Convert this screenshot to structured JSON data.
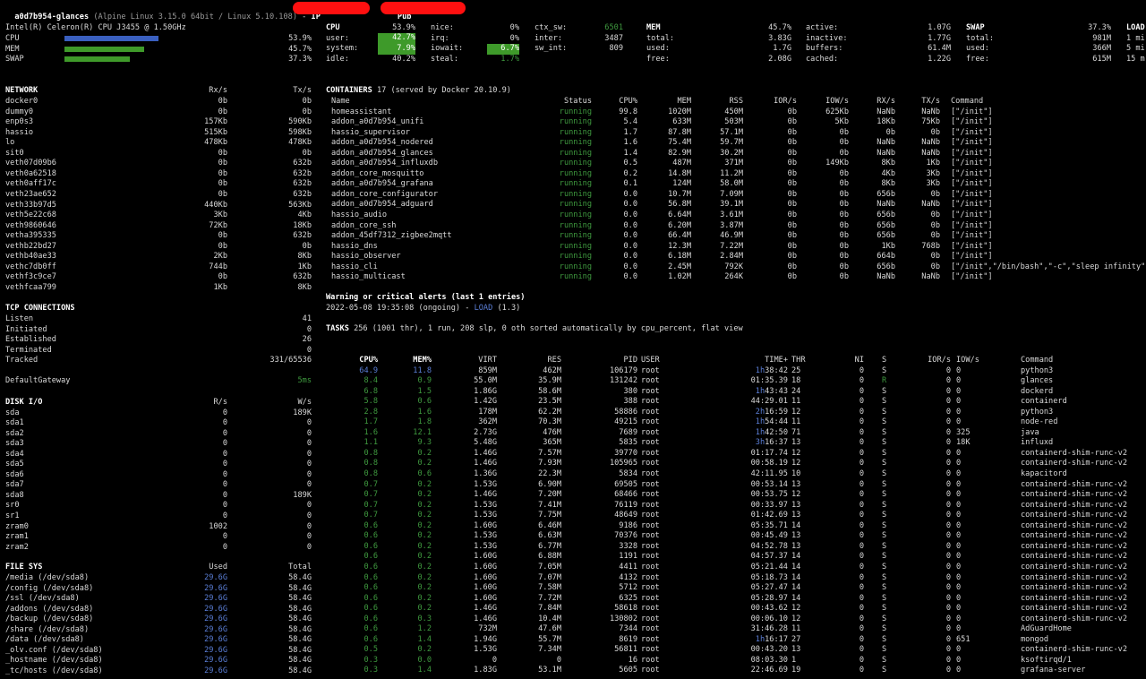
{
  "title": {
    "host": "a0d7b954-glances",
    "os": "(Alpine Linux 3.15.0 64bit / Linux 5.10.108)",
    "ip_label": "IP",
    "pub_label": "Pub"
  },
  "quicklook": {
    "cpu_name": "Intel(R) Celeron(R) CPU J3455 @ 1.50GHz",
    "rows": [
      {
        "label": "CPU",
        "value": "53.9%",
        "fraction": 0.539,
        "color": "#3a5fbf"
      },
      {
        "label": "MEM",
        "value": "45.7%",
        "fraction": 0.457,
        "color": "#3f9a2a"
      },
      {
        "label": "SWAP",
        "value": "37.3%",
        "fraction": 0.373,
        "color": "#3f9a2a"
      }
    ]
  },
  "cpu": {
    "title": "CPU",
    "total": "53.9%",
    "user_l": "user:",
    "user_v": "42.7%",
    "system_l": "system:",
    "system_v": "7.9%",
    "idle_l": "idle:",
    "idle_v": "40.2%",
    "nice_l": "nice:",
    "nice_v": "0%",
    "irq_l": "irq:",
    "irq_v": "0%",
    "iowait_l": "iowait:",
    "iowait_v": "6.7%",
    "steal_l": "steal:",
    "steal_v": "1.7%",
    "ctxsw_l": "ctx_sw:",
    "ctxsw_v": "6501",
    "inter_l": "inter:",
    "inter_v": "3487",
    "swint_l": "sw_int:",
    "swint_v": "809"
  },
  "mem": {
    "title": "MEM",
    "pct": "45.7%",
    "total_l": "total:",
    "total_v": "3.83G",
    "used_l": "used:",
    "used_v": "1.7G",
    "free_l": "free:",
    "free_v": "2.08G",
    "active_l": "active:",
    "active_v": "1.07G",
    "inactive_l": "inactive:",
    "inactive_v": "1.77G",
    "buffers_l": "buffers:",
    "buffers_v": "61.4M",
    "cached_l": "cached:",
    "cached_v": "1.22G"
  },
  "swap": {
    "title": "SWAP",
    "pct": "37.3%",
    "total_l": "total:",
    "total_v": "981M",
    "used_l": "used:",
    "used_v": "366M",
    "free_l": "free:",
    "free_v": "615M"
  },
  "load": {
    "title": "LOAD",
    "r1": "1 mi",
    "r2": "5 mi",
    "r3": "15 m"
  },
  "network": {
    "title": "NETWORK",
    "rx_h": "Rx/s",
    "tx_h": "Tx/s",
    "rows": [
      [
        "docker0",
        "0b",
        "0b"
      ],
      [
        "dummy0",
        "0b",
        "0b"
      ],
      [
        "enp0s3",
        "157Kb",
        "590Kb"
      ],
      [
        "hassio",
        "515Kb",
        "598Kb"
      ],
      [
        "lo",
        "478Kb",
        "478Kb"
      ],
      [
        "sit0",
        "0b",
        "0b"
      ],
      [
        "veth07d09b6",
        "0b",
        "632b"
      ],
      [
        "veth0a62518",
        "0b",
        "632b"
      ],
      [
        "veth0aff17c",
        "0b",
        "632b"
      ],
      [
        "veth23ae652",
        "0b",
        "632b"
      ],
      [
        "veth33b97d5",
        "440Kb",
        "563Kb"
      ],
      [
        "veth5e22c68",
        "3Kb",
        "4Kb"
      ],
      [
        "veth9860646",
        "72Kb",
        "18Kb"
      ],
      [
        "vetha395335",
        "0b",
        "632b"
      ],
      [
        "vethb22bd27",
        "0b",
        "0b"
      ],
      [
        "vethb40ae33",
        "2Kb",
        "8Kb"
      ],
      [
        "vethc7db0ff",
        "744b",
        "1Kb"
      ],
      [
        "vethf3c9ce7",
        "0b",
        "632b"
      ],
      [
        "vethfcaa799",
        "1Kb",
        "8Kb"
      ]
    ]
  },
  "tcp": {
    "title": "TCP CONNECTIONS",
    "rows": [
      [
        "Listen",
        "41"
      ],
      [
        "Initiated",
        "0"
      ],
      [
        "Established",
        "26"
      ],
      [
        "Terminated",
        "0"
      ],
      [
        "Tracked",
        "331/65536"
      ]
    ]
  },
  "gateway": {
    "label": "DefaultGateway",
    "value": "5ms"
  },
  "diskio": {
    "title": "DISK I/O",
    "r_h": "R/s",
    "w_h": "W/s",
    "rows": [
      [
        "sda",
        "0",
        "189K"
      ],
      [
        "sda1",
        "0",
        "0"
      ],
      [
        "sda2",
        "0",
        "0"
      ],
      [
        "sda3",
        "0",
        "0"
      ],
      [
        "sda4",
        "0",
        "0"
      ],
      [
        "sda5",
        "0",
        "0"
      ],
      [
        "sda6",
        "0",
        "0"
      ],
      [
        "sda7",
        "0",
        "0"
      ],
      [
        "sda8",
        "0",
        "189K"
      ],
      [
        "sr0",
        "0",
        "0"
      ],
      [
        "sr1",
        "0",
        "0"
      ],
      [
        "zram0",
        "1002",
        "0"
      ],
      [
        "zram1",
        "0",
        "0"
      ],
      [
        "zram2",
        "0",
        "0"
      ]
    ]
  },
  "filesys": {
    "title": "FILE SYS",
    "used_h": "Used",
    "total_h": "Total",
    "rows": [
      [
        "/media (/dev/sda8)",
        "29.6G",
        "58.4G"
      ],
      [
        "/config (/dev/sda8)",
        "29.6G",
        "58.4G"
      ],
      [
        "/ssl (/dev/sda8)",
        "29.6G",
        "58.4G"
      ],
      [
        "/addons (/dev/sda8)",
        "29.6G",
        "58.4G"
      ],
      [
        "/backup (/dev/sda8)",
        "29.6G",
        "58.4G"
      ],
      [
        "/share (/dev/sda8)",
        "29.6G",
        "58.4G"
      ],
      [
        "/data (/dev/sda8)",
        "29.6G",
        "58.4G"
      ],
      [
        "_olv.conf (/dev/sda8)",
        "29.6G",
        "58.4G"
      ],
      [
        "_hostname (/dev/sda8)",
        "29.6G",
        "58.4G"
      ],
      [
        "_tc/hosts (/dev/sda8)",
        "29.6G",
        "58.4G"
      ]
    ]
  },
  "containers": {
    "title": "CONTAINERS",
    "summary": "17 (served by Docker 20.10.9)",
    "headers": [
      "Name",
      "Status",
      "CPU%",
      "MEM",
      "RSS",
      "IOR/s",
      "IOW/s",
      "RX/s",
      "TX/s",
      "Command"
    ],
    "rows": [
      [
        "homeassistant",
        "running",
        "99.8",
        "1020M",
        "450M",
        "0b",
        "625Kb",
        "NaNb",
        "NaNb",
        "[\"/init\"]"
      ],
      [
        "addon_a0d7b954_unifi",
        "running",
        "5.4",
        "633M",
        "503M",
        "0b",
        "5Kb",
        "18Kb",
        "75Kb",
        "[\"/init\"]"
      ],
      [
        "hassio_supervisor",
        "running",
        "1.7",
        "87.8M",
        "57.1M",
        "0b",
        "0b",
        "0b",
        "0b",
        "[\"/init\"]"
      ],
      [
        "addon_a0d7b954_nodered",
        "running",
        "1.6",
        "75.4M",
        "59.7M",
        "0b",
        "0b",
        "NaNb",
        "NaNb",
        "[\"/init\"]"
      ],
      [
        "addon_a0d7b954_glances",
        "running",
        "1.4",
        "82.9M",
        "30.2M",
        "0b",
        "0b",
        "NaNb",
        "NaNb",
        "[\"/init\"]"
      ],
      [
        "addon_a0d7b954_influxdb",
        "running",
        "0.5",
        "487M",
        "371M",
        "0b",
        "149Kb",
        "8Kb",
        "1Kb",
        "[\"/init\"]"
      ],
      [
        "addon_core_mosquitto",
        "running",
        "0.2",
        "14.8M",
        "11.2M",
        "0b",
        "0b",
        "4Kb",
        "3Kb",
        "[\"/init\"]"
      ],
      [
        "addon_a0d7b954_grafana",
        "running",
        "0.1",
        "124M",
        "58.0M",
        "0b",
        "0b",
        "8Kb",
        "3Kb",
        "[\"/init\"]"
      ],
      [
        "addon_core_configurator",
        "running",
        "0.0",
        "10.7M",
        "7.09M",
        "0b",
        "0b",
        "656b",
        "0b",
        "[\"/init\"]"
      ],
      [
        "addon_a0d7b954_adguard",
        "running",
        "0.0",
        "56.8M",
        "39.1M",
        "0b",
        "0b",
        "NaNb",
        "NaNb",
        "[\"/init\"]"
      ],
      [
        "hassio_audio",
        "running",
        "0.0",
        "6.64M",
        "3.61M",
        "0b",
        "0b",
        "656b",
        "0b",
        "[\"/init\"]"
      ],
      [
        "addon_core_ssh",
        "running",
        "0.0",
        "6.20M",
        "3.87M",
        "0b",
        "0b",
        "656b",
        "0b",
        "[\"/init\"]"
      ],
      [
        "addon_45df7312_zigbee2mqtt",
        "running",
        "0.0",
        "66.4M",
        "46.9M",
        "0b",
        "0b",
        "656b",
        "0b",
        "[\"/init\"]"
      ],
      [
        "hassio_dns",
        "running",
        "0.0",
        "12.3M",
        "7.22M",
        "0b",
        "0b",
        "1Kb",
        "768b",
        "[\"/init\"]"
      ],
      [
        "hassio_observer",
        "running",
        "0.0",
        "6.18M",
        "2.84M",
        "0b",
        "0b",
        "664b",
        "0b",
        "[\"/init\"]"
      ],
      [
        "hassio_cli",
        "running",
        "0.0",
        "2.45M",
        "792K",
        "0b",
        "0b",
        "656b",
        "0b",
        "[\"/init\",\"/bin/bash\",\"-c\",\"sleep infinity\"]"
      ],
      [
        "hassio_multicast",
        "running",
        "0.0",
        "1.02M",
        "264K",
        "0b",
        "0b",
        "NaNb",
        "NaNb",
        "[\"/init\"]"
      ]
    ]
  },
  "alerts": {
    "title": "Warning or critical alerts (last 1 entries)",
    "entry_time": "2022-05-08 19:35:08 (ongoing) - ",
    "entry_type": "LOAD",
    "entry_value": " (1.3)"
  },
  "tasks": {
    "label": "TASKS",
    "summary": "256 (1001 thr), 1 run, 208 slp, 0 oth sorted automatically by cpu_percent, flat view"
  },
  "processes": {
    "headers": [
      "CPU%",
      "MEM%",
      "VIRT",
      "RES",
      "PID",
      "USER",
      "TIME+",
      "THR",
      "NI",
      "S",
      "IOR/s",
      "IOW/s",
      "Command"
    ],
    "rows": [
      [
        "64.9",
        "11.8",
        "859M",
        "462M",
        "106179",
        "root",
        "1h",
        "38:42",
        "25",
        "0",
        "S",
        "0",
        "0",
        "python3"
      ],
      [
        "8.4",
        "0.9",
        "55.0M",
        "35.9M",
        "131242",
        "root",
        "",
        "01:35.39",
        "18",
        "0",
        "R",
        "0",
        "0",
        "glances"
      ],
      [
        "6.8",
        "1.5",
        "1.86G",
        "58.6M",
        "380",
        "root",
        "1h",
        "43:43",
        "24",
        "0",
        "S",
        "0",
        "0",
        "dockerd"
      ],
      [
        "5.8",
        "0.6",
        "1.42G",
        "23.5M",
        "388",
        "root",
        "",
        "44:29.01",
        "11",
        "0",
        "S",
        "0",
        "0",
        "containerd"
      ],
      [
        "2.8",
        "1.6",
        "178M",
        "62.2M",
        "58886",
        "root",
        "2h",
        "16:59",
        "12",
        "0",
        "S",
        "0",
        "0",
        "python3"
      ],
      [
        "1.7",
        "1.8",
        "362M",
        "70.3M",
        "49215",
        "root",
        "1h",
        "54:44",
        "11",
        "0",
        "S",
        "0",
        "0",
        "node-red"
      ],
      [
        "1.6",
        "12.1",
        "2.73G",
        "476M",
        "7689",
        "root",
        "1h",
        "42:50",
        "71",
        "0",
        "S",
        "0",
        "325",
        "java"
      ],
      [
        "1.1",
        "9.3",
        "5.48G",
        "365M",
        "5835",
        "root",
        "3h",
        "16:37",
        "13",
        "0",
        "S",
        "0",
        "18K",
        "influxd"
      ],
      [
        "0.8",
        "0.2",
        "1.46G",
        "7.57M",
        "39770",
        "root",
        "",
        "01:17.74",
        "12",
        "0",
        "S",
        "0",
        "0",
        "containerd-shim-runc-v2"
      ],
      [
        "0.8",
        "0.2",
        "1.46G",
        "7.93M",
        "105965",
        "root",
        "",
        "00:58.19",
        "12",
        "0",
        "S",
        "0",
        "0",
        "containerd-shim-runc-v2"
      ],
      [
        "0.8",
        "0.6",
        "1.36G",
        "22.3M",
        "5834",
        "root",
        "",
        "42:11.95",
        "10",
        "0",
        "S",
        "0",
        "0",
        "kapacitord"
      ],
      [
        "0.7",
        "0.2",
        "1.53G",
        "6.90M",
        "69505",
        "root",
        "",
        "00:53.14",
        "13",
        "0",
        "S",
        "0",
        "0",
        "containerd-shim-runc-v2"
      ],
      [
        "0.7",
        "0.2",
        "1.46G",
        "7.20M",
        "68466",
        "root",
        "",
        "00:53.75",
        "12",
        "0",
        "S",
        "0",
        "0",
        "containerd-shim-runc-v2"
      ],
      [
        "0.7",
        "0.2",
        "1.53G",
        "7.41M",
        "76119",
        "root",
        "",
        "00:33.97",
        "13",
        "0",
        "S",
        "0",
        "0",
        "containerd-shim-runc-v2"
      ],
      [
        "0.7",
        "0.2",
        "1.53G",
        "7.75M",
        "48649",
        "root",
        "",
        "01:42.69",
        "13",
        "0",
        "S",
        "0",
        "0",
        "containerd-shim-runc-v2"
      ],
      [
        "0.6",
        "0.2",
        "1.60G",
        "6.46M",
        "9186",
        "root",
        "",
        "05:35.71",
        "14",
        "0",
        "S",
        "0",
        "0",
        "containerd-shim-runc-v2"
      ],
      [
        "0.6",
        "0.2",
        "1.53G",
        "6.63M",
        "70376",
        "root",
        "",
        "00:45.49",
        "13",
        "0",
        "S",
        "0",
        "0",
        "containerd-shim-runc-v2"
      ],
      [
        "0.6",
        "0.2",
        "1.53G",
        "6.77M",
        "3328",
        "root",
        "",
        "04:52.78",
        "13",
        "0",
        "S",
        "0",
        "0",
        "containerd-shim-runc-v2"
      ],
      [
        "0.6",
        "0.2",
        "1.60G",
        "6.88M",
        "1191",
        "root",
        "",
        "04:57.37",
        "14",
        "0",
        "S",
        "0",
        "0",
        "containerd-shim-runc-v2"
      ],
      [
        "0.6",
        "0.2",
        "1.60G",
        "7.05M",
        "4411",
        "root",
        "",
        "05:21.44",
        "14",
        "0",
        "S",
        "0",
        "0",
        "containerd-shim-runc-v2"
      ],
      [
        "0.6",
        "0.2",
        "1.60G",
        "7.07M",
        "4132",
        "root",
        "",
        "05:18.73",
        "14",
        "0",
        "S",
        "0",
        "0",
        "containerd-shim-runc-v2"
      ],
      [
        "0.6",
        "0.2",
        "1.60G",
        "7.58M",
        "5712",
        "root",
        "",
        "05:27.47",
        "14",
        "0",
        "S",
        "0",
        "0",
        "containerd-shim-runc-v2"
      ],
      [
        "0.6",
        "0.2",
        "1.60G",
        "7.72M",
        "6325",
        "root",
        "",
        "05:28.97",
        "14",
        "0",
        "S",
        "0",
        "0",
        "containerd-shim-runc-v2"
      ],
      [
        "0.6",
        "0.2",
        "1.46G",
        "7.84M",
        "58618",
        "root",
        "",
        "00:43.62",
        "12",
        "0",
        "S",
        "0",
        "0",
        "containerd-shim-runc-v2"
      ],
      [
        "0.6",
        "0.3",
        "1.46G",
        "10.4M",
        "130802",
        "root",
        "",
        "00:06.10",
        "12",
        "0",
        "S",
        "0",
        "0",
        "containerd-shim-runc-v2"
      ],
      [
        "0.6",
        "1.2",
        "732M",
        "47.6M",
        "7344",
        "root",
        "",
        "31:46.28",
        "11",
        "0",
        "S",
        "0",
        "0",
        "AdGuardHome"
      ],
      [
        "0.6",
        "1.4",
        "1.94G",
        "55.7M",
        "8619",
        "root",
        "1h",
        "16:17",
        "27",
        "0",
        "S",
        "0",
        "651",
        "mongod"
      ],
      [
        "0.5",
        "0.2",
        "1.53G",
        "7.34M",
        "56811",
        "root",
        "",
        "00:43.20",
        "13",
        "0",
        "S",
        "0",
        "0",
        "containerd-shim-runc-v2"
      ],
      [
        "0.3",
        "0.0",
        "0",
        "0",
        "16",
        "root",
        "",
        "08:03.30",
        "1",
        "0",
        "S",
        "0",
        "0",
        "ksoftirqd/1"
      ],
      [
        "0.3",
        "1.4",
        "1.83G",
        "53.1M",
        "5605",
        "root",
        "",
        "22:46.69",
        "19",
        "0",
        "S",
        "0",
        "0",
        "grafana-server"
      ]
    ]
  }
}
